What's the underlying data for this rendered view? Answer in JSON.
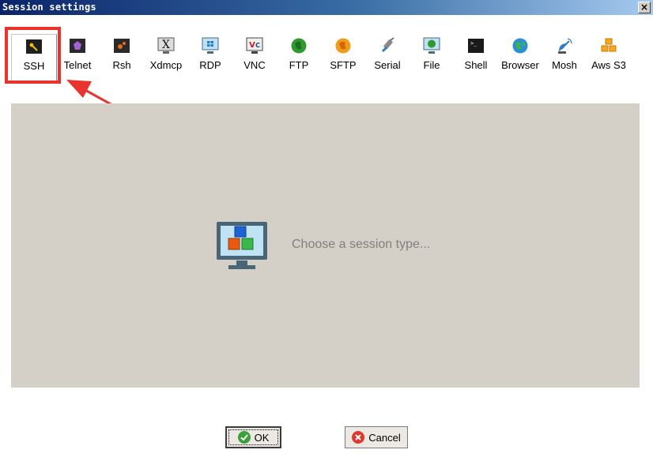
{
  "window": {
    "title": "Session settings",
    "close_glyph": "×"
  },
  "toolbar": {
    "items": [
      {
        "label": "SSH",
        "icon": "ssh-key-icon",
        "selected": true
      },
      {
        "label": "Telnet",
        "icon": "telnet-icon"
      },
      {
        "label": "Rsh",
        "icon": "rsh-icon"
      },
      {
        "label": "Xdmcp",
        "icon": "xdmcp-icon"
      },
      {
        "label": "RDP",
        "icon": "rdp-icon"
      },
      {
        "label": "VNC",
        "icon": "vnc-icon"
      },
      {
        "label": "FTP",
        "icon": "ftp-icon"
      },
      {
        "label": "SFTP",
        "icon": "sftp-icon"
      },
      {
        "label": "Serial",
        "icon": "serial-icon"
      },
      {
        "label": "File",
        "icon": "file-icon"
      },
      {
        "label": "Shell",
        "icon": "shell-icon"
      },
      {
        "label": "Browser",
        "icon": "browser-icon"
      },
      {
        "label": "Mosh",
        "icon": "mosh-icon"
      },
      {
        "label": "Aws S3",
        "icon": "aws-s3-icon"
      }
    ]
  },
  "panel": {
    "hint": "Choose a session type..."
  },
  "buttons": {
    "ok": "OK",
    "cancel": "Cancel"
  },
  "colors": {
    "highlight": "#e8332e",
    "panel_bg": "#d4d0c8"
  }
}
